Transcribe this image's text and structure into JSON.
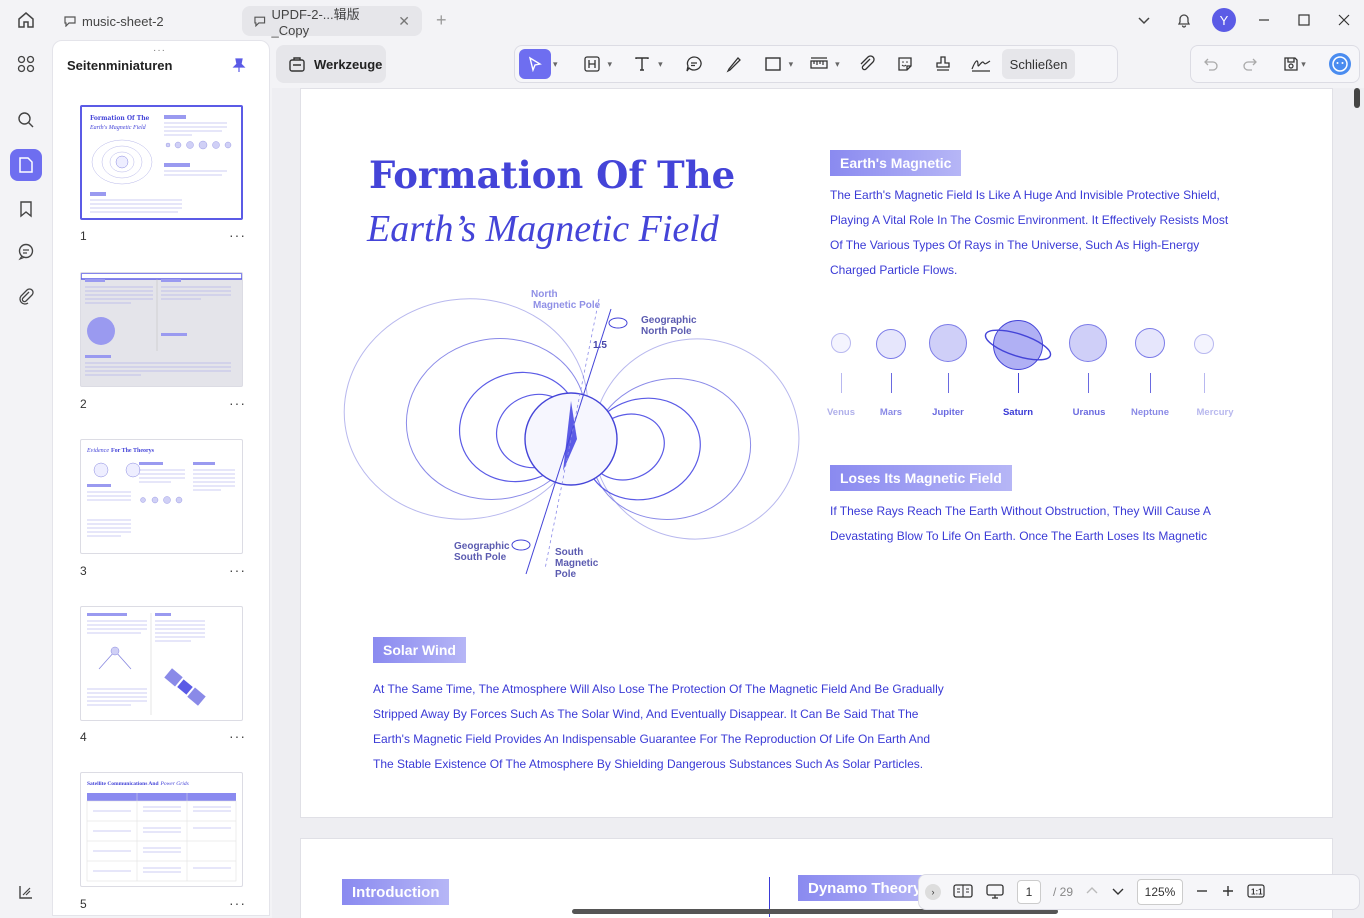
{
  "tabs": [
    {
      "label": "music-sheet-2"
    },
    {
      "label": "UPDF-2-...辑版_Copy"
    }
  ],
  "user": {
    "initial": "Y"
  },
  "sidebar": {
    "title": "Seitenminiaturen",
    "pages": [
      "1",
      "2",
      "3",
      "4",
      "5"
    ],
    "more": "···"
  },
  "toolbar": {
    "tools_label": "Werkzeuge",
    "close_label": "Schließen"
  },
  "page1": {
    "title_line1": "Formation Of The",
    "title_line2": "Earth’s Magnetic Field",
    "section1": {
      "heading": "Earth's Magnetic",
      "lines": [
        "The Earth's Magnetic Field Is Like A Huge And Invisible Protective Shield,",
        "Playing A Vital Role In The Cosmic Environment. It Effectively Resists Most",
        "Of The Various Types Of Rays in The Universe, Such As High-Energy",
        "Charged Particle Flows."
      ]
    },
    "planets": [
      "Venus",
      "Mars",
      "Jupiter",
      "Saturn",
      "Uranus",
      "Neptune",
      "Mercury"
    ],
    "section2": {
      "heading": "Loses Its Magnetic Field",
      "lines": [
        "If These Rays Reach The Earth Without Obstruction, They Will Cause A",
        "Devastating Blow To Life On Earth. Once The Earth Loses Its Magnetic"
      ]
    },
    "section3": {
      "heading": "Solar Wind",
      "lines": [
        "At The Same Time, The Atmosphere Will Also Lose The Protection Of The Magnetic Field And Be Gradually",
        "Stripped Away By Forces Such As The Solar Wind, And Eventually Disappear. It Can Be Said That The",
        "Earth's Magnetic Field Provides An Indispensable Guarantee For The Reproduction Of Life On Earth And",
        "The Stable Existence Of The Atmosphere By Shielding Dangerous Substances Such As Solar Particles."
      ]
    },
    "diagram": {
      "north_mag": [
        "North",
        "Magnetic Pole"
      ],
      "geo_north": [
        "Geographic",
        "North Pole"
      ],
      "angle": "1.5",
      "geo_south": [
        "Geographic",
        "South Pole"
      ],
      "south_mag": [
        "South",
        "Magnetic",
        "Pole"
      ]
    }
  },
  "page2": {
    "left_heading": "Introduction",
    "right_heading": "Dynamo Theory"
  },
  "nav": {
    "current_page": "1",
    "total": "/ 29",
    "zoom": "125%"
  },
  "thumb_text": {
    "t1_title": "Formation Of The",
    "t1_sub": "Earth's Magnetic Field",
    "t3_title_a": "Evidence",
    "t3_title_b": "For The Theorys",
    "t5_title_a": "Satellite Communications And",
    "t5_title_b": "Power Grids"
  },
  "colors": {
    "accent": "#5b5be6",
    "text_blue": "#3a3ad6"
  }
}
